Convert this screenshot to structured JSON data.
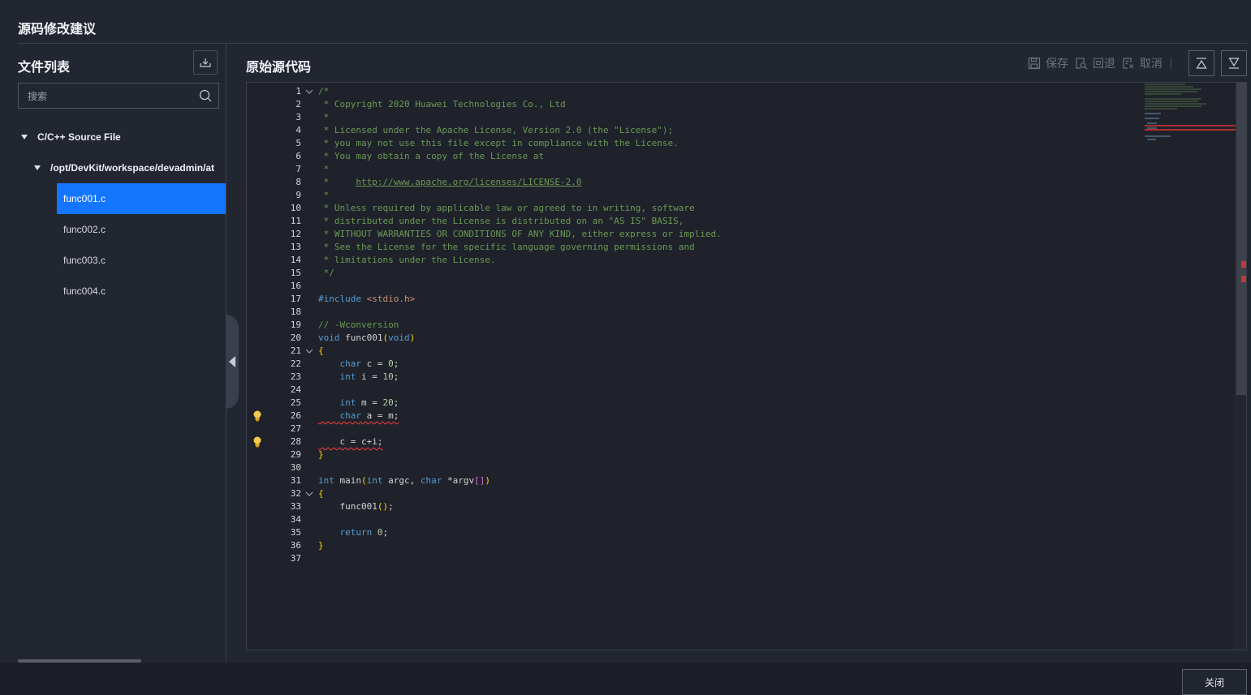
{
  "dialog": {
    "title": "源码修改建议",
    "close_label": "关闭"
  },
  "file_list": {
    "title": "文件列表",
    "search_placeholder": "搜索",
    "category": "C/C++ Source File",
    "folder": "/opt/DevKit/workspace/devadmin/at",
    "files": [
      "func001.c",
      "func002.c",
      "func003.c",
      "func004.c"
    ],
    "selected": "func001.c"
  },
  "source": {
    "title": "原始源代码",
    "actions": {
      "save": "保存",
      "rollback": "回退",
      "cancel": "取消"
    }
  },
  "code_lines": [
    "/*",
    " * Copyright 2020 Huawei Technologies Co., Ltd",
    " *",
    " * Licensed under the Apache License, Version 2.0 (the \"License\");",
    " * you may not use this file except in compliance with the License.",
    " * You may obtain a copy of the License at",
    " *",
    " *     http://www.apache.org/licenses/LICENSE-2.0",
    " *",
    " * Unless required by applicable law or agreed to in writing, software",
    " * distributed under the License is distributed on an \"AS IS\" BASIS,",
    " * WITHOUT WARRANTIES OR CONDITIONS OF ANY KIND, either express or implied.",
    " * See the License for the specific language governing permissions and",
    " * limitations under the License.",
    " */",
    "",
    "#include <stdio.h>",
    "",
    "// -Wconversion",
    "void func001(void)",
    "{",
    "    char c = 0;",
    "    int i = 10;",
    "",
    "    int m = 20;",
    "    char a = m;",
    "",
    "    c = c+i;",
    "}",
    "",
    "int main(int argc, char *argv[])",
    "{",
    "    func001();",
    "",
    "    return 0;",
    "}",
    ""
  ],
  "fold_lines": [
    1,
    21,
    32
  ],
  "warning_lines": [
    26,
    28
  ]
}
